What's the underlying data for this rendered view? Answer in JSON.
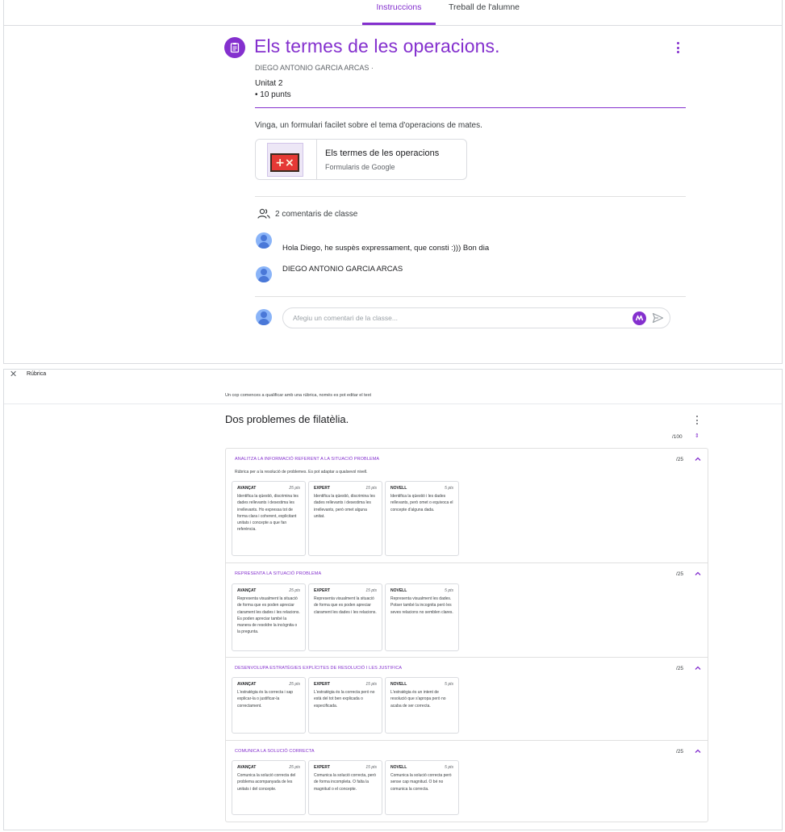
{
  "tabs": {
    "instructions": "Instruccions",
    "student_work": "Treball de l'alumne"
  },
  "assignment": {
    "title": "Els termes de les operacions.",
    "author": "DIEGO ANTONIO GARCIA ARCAS ·",
    "unit": "Unitat 2",
    "points": "• 10 punts",
    "description": "Vinga, un formulari facilet sobre el tema d'operacions de mates.",
    "attachment": {
      "title": "Els termes de les operacions",
      "type": "Formularis de Google",
      "thumbnail_symbol": "+×"
    }
  },
  "comments": {
    "header": "2 comentaris de classe",
    "items": [
      {
        "text": "Hola Diego, he suspès expressament, que consti :))) Bon dia"
      },
      {
        "text": "DIEGO ANTONIO GARCIA ARCAS"
      }
    ],
    "input_placeholder": "Afegiu un comentari de la classe..."
  },
  "colors": {
    "accent": "#8430ce",
    "avatar": "#8ab4f8",
    "border": "#dadce0"
  },
  "icons": [
    "assignment-icon",
    "more-vert-icon",
    "people-icon",
    "avatar-icon",
    "ai-assist-icon",
    "send-icon",
    "close-icon",
    "expand-icon",
    "chevron-up-icon"
  ],
  "rubric": {
    "header_title": "Rúbrica",
    "close_glyph": "✕",
    "notice": "Un cop comences a qualificar amb una rúbrica, només es pot editar el text",
    "title": "Dos problemes de filatèlia.",
    "total": "/100",
    "expand_glyph": "⇕",
    "criteria": [
      {
        "title": "ANALITZA LA INFORMACIÓ REFERENT A LA SITUACIÓ PROBLEMA",
        "points": "/25",
        "description": "Rúbrica per a la resolució de problemes. Es pot adaptar a qualsevol nivell.",
        "levels": [
          {
            "name": "AVANÇAT",
            "points": "25 pts",
            "text": "Identifica la qüestió, discrimina les dades rellevants i desestima les irrellevants. Ho expressa tot de forma clara i coherent, explicitant unitats i concepte a que fan referència."
          },
          {
            "name": "EXPERT",
            "points": "15 pts",
            "text": "Identifica la qüestió, discrimina les dades rellevants i desestima les irrellevants, però omet alguna unitat."
          },
          {
            "name": "NOVELL",
            "points": "5 pts",
            "text": "Identifica la qüestió i les dades rellevants, però omet o equivoca el concepte d'alguna dada."
          }
        ]
      },
      {
        "title": "REPRESENTA LA SITUACIÓ PROBLEMA",
        "points": "/25",
        "description": "",
        "levels": [
          {
            "name": "AVANÇAT",
            "points": "25 pts",
            "text": "Representa visualment la situació de forma que es poden apreciar clarament les dades i les relacions. Es poden apreciar també la manera de resoldre la incògnita o la pregunta."
          },
          {
            "name": "EXPERT",
            "points": "15 pts",
            "text": "Representa visualment la situació de forma que es poden apreciar clarament les dades i les relacions."
          },
          {
            "name": "NOVELL",
            "points": "5 pts",
            "text": "Representa visualment les dades. Potser també la incognita però les seves relacions no semblen clares."
          }
        ]
      },
      {
        "title": "DESENVOLUPA ESTRATÈGIES EXPLÍCITES DE RESOLUCIÓ I LES JUSTIFICA",
        "points": "/25",
        "description": "",
        "levels": [
          {
            "name": "AVANÇAT",
            "points": "25 pts",
            "text": "L'estratègia és la correcta i sap explicar-la o justificar-la correctament."
          },
          {
            "name": "EXPERT",
            "points": "15 pts",
            "text": "L'estratègia és la correcta però no està del tot ben explicada o especificada."
          },
          {
            "name": "NOVELL",
            "points": "5 pts",
            "text": "L'estratègia és un intent de resolució que s'apropa però no acaba de ser correcta."
          }
        ]
      },
      {
        "title": "COMUNICA LA SOLUCIÓ CORRECTA",
        "points": "/25",
        "description": "",
        "levels": [
          {
            "name": "AVANÇAT",
            "points": "25 pts",
            "text": "Comunica la solució correcta del problema acompanyada de les unitats i del concepte."
          },
          {
            "name": "EXPERT",
            "points": "15 pts",
            "text": "Comunica la solució correcta, però de forma incompleta. O falta la magnitud o el concepte."
          },
          {
            "name": "NOVELL",
            "points": "5 pts",
            "text": "Comunica la solució correcta però sense cap magnitud. O bé no comunica la correcta."
          }
        ]
      }
    ]
  }
}
